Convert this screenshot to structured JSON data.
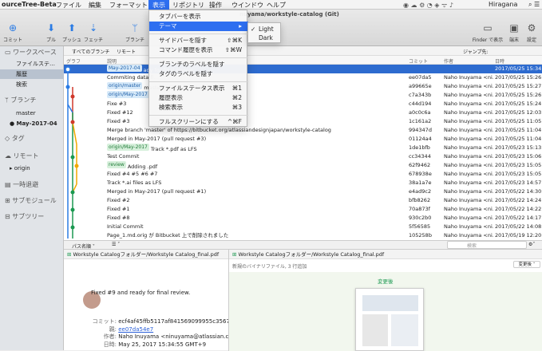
{
  "menubar": {
    "app": "ourceTree-Beta",
    "items": [
      "ファイル",
      "編集",
      "フォーマット",
      "表示",
      "リポジトリ",
      "操作",
      "ウインドウ",
      "ヘルプ"
    ],
    "title": "nuyama/workstyle-catalog (Git)",
    "ime": "Hiragana"
  },
  "toolbar": {
    "commit": "コミット",
    "pull": "プル",
    "push": "プッシュ",
    "fetch": "フェッチ",
    "branch": "ブランチ",
    "finder": "Finder で表示",
    "terminal": "端末",
    "settings": "設定"
  },
  "sidebar": {
    "workspace": "ワークスペース",
    "file_status": "ファイルステ…",
    "history": "履歴",
    "search": "検索",
    "branches": "ブランチ",
    "master": "master",
    "may": "May-2017-04",
    "tags": "タグ",
    "remotes": "リモート",
    "origin": "origin",
    "stash": "一時退避",
    "submodules": "サブモジュール",
    "subtree": "サブツリー"
  },
  "filter": {
    "all_branches": "すべてのブランチ",
    "remote": "リモート",
    "jump": "ジャンプ先:"
  },
  "columns": {
    "graph": "グラフ",
    "desc": "説明",
    "commit": "コミット",
    "author": "作者",
    "date": "日時"
  },
  "commits": [
    {
      "tags": [
        "May-2017-04"
      ],
      "tagstyle": "b",
      "desc": "ady for final review.",
      "hash": "",
      "author": "",
      "date": "2017/05/25 15:34"
    },
    {
      "tags": [],
      "desc": "Commiting data fi…",
      "hash": "ee07da5",
      "author": "Naho Inuyama <ni…",
      "date": "2017/05/25 15:26"
    },
    {
      "tags": [
        "origin/master"
      ],
      "tagstyle": "b",
      "desc": "master にマージしました。",
      "hash": "a99665e",
      "author": "Naho Inuyama <ni…",
      "date": "2017/05/25 15:27"
    },
    {
      "tags": [
        "origin/May-2017"
      ],
      "tagstyle": "b",
      "desc": "",
      "hash": "c7a343b",
      "author": "Naho Inuyama <ni…",
      "date": "2017/05/25 15:26"
    },
    {
      "tags": [],
      "desc": "Fixe #3",
      "hash": "c44d194",
      "author": "Naho Inuyama <ni…",
      "date": "2017/05/25 15:24"
    },
    {
      "tags": [],
      "desc": "Fixed #12",
      "hash": "a0c0c6a",
      "author": "Naho Inuyama <ni…",
      "date": "2017/05/25 12:03"
    },
    {
      "tags": [],
      "desc": "Fixed #3",
      "hash": "1c161a2",
      "author": "Naho Inuyama <ni…",
      "date": "2017/05/25 11:05"
    },
    {
      "tags": [],
      "desc": "Merge branch 'master' of https://bitbucket.org/atlassiandesignjapan/workstyle-catalog",
      "hash": "994347d",
      "author": "Naho Inuyama <ni…",
      "date": "2017/05/25 11:04"
    },
    {
      "tags": [],
      "desc": "Merged in May-2017 (pull request #3)",
      "hash": "01124a4",
      "author": "Naho Inuyama <ni…",
      "date": "2017/05/25 11:04"
    },
    {
      "tags": [
        "origin/May-2017"
      ],
      "tagstyle": "g",
      "desc": "Track *.pdf as LFS",
      "hash": "1de1bfb",
      "author": "Naho Inuyama <ni…",
      "date": "2017/05/23 15:13"
    },
    {
      "tags": [],
      "desc": "Test Commit",
      "hash": "cc34344",
      "author": "Naho Inuyama <ni…",
      "date": "2017/05/23 15:06"
    },
    {
      "tags": [
        "review"
      ],
      "tagstyle": "g",
      "desc": "Adding .pdf",
      "hash": "62f9462",
      "author": "Naho Inuyama <ni…",
      "date": "2017/05/23 15:05"
    },
    {
      "tags": [],
      "desc": "Fixed #4 #5 #6 #7",
      "hash": "678938e",
      "author": "Naho Inuyama <ni…",
      "date": "2017/05/23 15:05"
    },
    {
      "tags": [],
      "desc": "Track *.ai files as LFS",
      "hash": "38a1a7e",
      "author": "Naho Inuyama <ni…",
      "date": "2017/05/23 14:57"
    },
    {
      "tags": [],
      "desc": "Merged in May-2017 (pull request #1)",
      "hash": "e4ad9c2",
      "author": "Naho Inuyama <ni…",
      "date": "2017/05/22 14:30"
    },
    {
      "tags": [],
      "desc": "Fixed #2",
      "hash": "bfb8262",
      "author": "Naho Inuyama <ni…",
      "date": "2017/05/22 14:24"
    },
    {
      "tags": [],
      "desc": "Fixed #1",
      "hash": "70a873f",
      "author": "Naho Inuyama <ni…",
      "date": "2017/05/22 14:22"
    },
    {
      "tags": [],
      "desc": "Fixed #8",
      "hash": "930c2b0",
      "author": "Naho Inuyama <ni…",
      "date": "2017/05/22 14:17"
    },
    {
      "tags": [],
      "desc": "Initial Commit",
      "hash": "5f56585",
      "author": "Naho Inuyama <ni…",
      "date": "2017/05/22 14:08"
    },
    {
      "tags": [],
      "desc": "Page_1.md.orig が Bitbucket 上で削除されました",
      "hash": "105258b",
      "author": "Naho Inuyama <ni…",
      "date": "2017/05/19 12:20"
    }
  ],
  "bottombar": {
    "sort": "パス名順 ˅",
    "search": "検索"
  },
  "view_menu": {
    "items": [
      {
        "label": "タブバーを表示",
        "sc": ""
      },
      {
        "label": "テーマ",
        "sc": "▸",
        "hl": true
      },
      {
        "sep": true
      },
      {
        "label": "サイドバーを隠す",
        "sc": "⇧⌘K"
      },
      {
        "label": "コマンド履歴を表示",
        "sc": "⇧⌘W"
      },
      {
        "sep": true
      },
      {
        "label": "ブランチのラベルを隠す",
        "sc": ""
      },
      {
        "label": "タグのラベルを隠す",
        "sc": ""
      },
      {
        "sep": true
      },
      {
        "label": "ファイルステータス表示",
        "sc": "⌘1"
      },
      {
        "label": "履歴表示",
        "sc": "⌘2"
      },
      {
        "label": "検索表示",
        "sc": "⌘3"
      },
      {
        "sep": true
      },
      {
        "label": "フルスクリーンにする",
        "sc": "^⌘F"
      }
    ]
  },
  "theme_menu": {
    "light": "Light",
    "dark": "Dark",
    "check": "✓"
  },
  "file_panel": {
    "file": "Workstyle Catalogフォルダー/Workstyle Catalog_final.pdf"
  },
  "detail": {
    "message": "Fixed #9 and ready for final review.",
    "commit_label": "コミット:",
    "commit": "ecf4af45ffb5117af841569099955c3567d7",
    "parent_label": "親:",
    "parent": "ee07da54e7",
    "author_label": "作者:",
    "author": "Naho Inuyama <ninuyama@atlassian.com",
    "date_label": "日時:",
    "date": "May 25, 2017 15:34:55 GMT+9"
  },
  "diff": {
    "file": "Workstyle Catalogフォルダー/Workstyle Catalog_final.pdf",
    "info": "新規のバイナリファイル, 3 行追加",
    "mode": "変更後 ˅",
    "after": "変更後"
  }
}
